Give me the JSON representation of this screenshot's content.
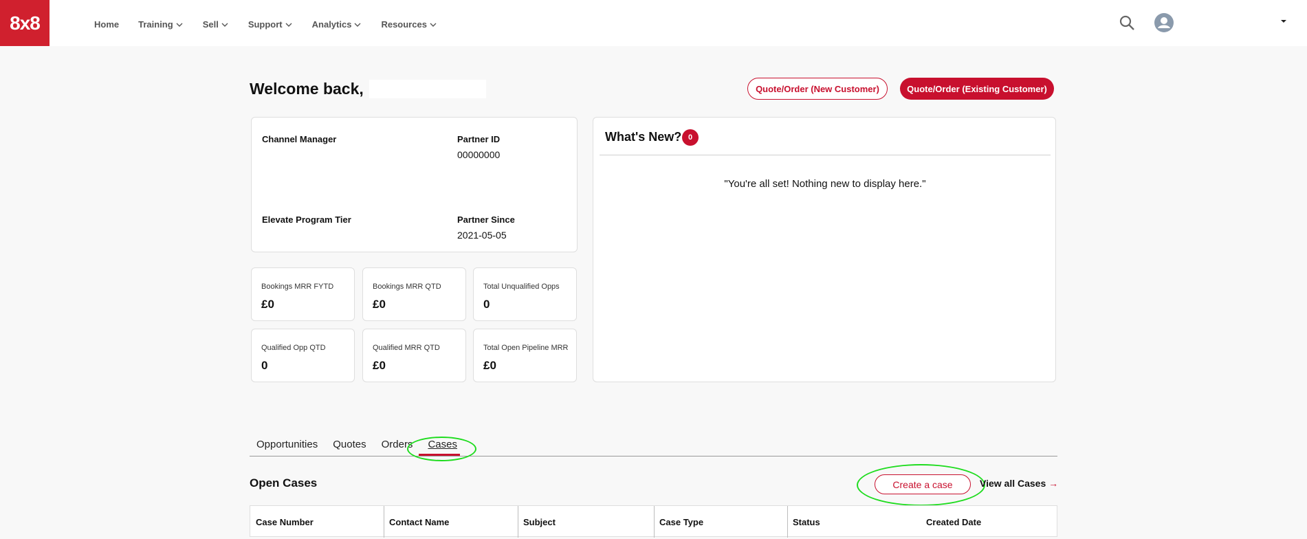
{
  "brand": {
    "logo_text": "8x8",
    "accent": "#c8102e"
  },
  "nav": {
    "items": [
      {
        "label": "Home",
        "dropdown": false
      },
      {
        "label": "Training",
        "dropdown": true
      },
      {
        "label": "Sell",
        "dropdown": true
      },
      {
        "label": "Support",
        "dropdown": true
      },
      {
        "label": "Analytics",
        "dropdown": true
      },
      {
        "label": "Resources",
        "dropdown": true
      }
    ],
    "icons": [
      "search-icon",
      "user-avatar-icon",
      "caret-down-icon"
    ]
  },
  "header": {
    "welcome": "Welcome back,",
    "quote_new": "Quote/Order (New Customer)",
    "quote_existing": "Quote/Order (Existing Customer)"
  },
  "info": {
    "channel_manager_label": "Channel Manager",
    "partner_id_label": "Partner ID",
    "partner_id_value": "00000000",
    "tier_label": "Elevate Program Tier",
    "partner_since_label": "Partner Since",
    "partner_since_value": "2021-05-05"
  },
  "metrics": [
    {
      "label": "Bookings MRR FYTD",
      "value": "£0"
    },
    {
      "label": "Bookings MRR QTD",
      "value": "£0"
    },
    {
      "label": "Total Unqualified Opps",
      "value": "0"
    },
    {
      "label": "Qualified Opp QTD",
      "value": "0"
    },
    {
      "label": "Qualified MRR QTD",
      "value": "£0"
    },
    {
      "label": "Total Open Pipeline MRR",
      "value": "£0"
    }
  ],
  "whats_new": {
    "title": "What's New?",
    "count": "0",
    "empty_text": "\"You're all set! Nothing new to display here.\""
  },
  "tabs": [
    {
      "label": "Opportunities",
      "active": false
    },
    {
      "label": "Quotes",
      "active": false
    },
    {
      "label": "Orders",
      "active": false
    },
    {
      "label": "Cases",
      "active": true
    }
  ],
  "cases": {
    "title": "Open Cases",
    "create_label": "Create a case",
    "view_all_label": "View all Cases",
    "view_all_arrow": "→",
    "columns": [
      "Case Number",
      "Contact Name",
      "Subject",
      "Case Type",
      "Status",
      "Created Date"
    ]
  }
}
